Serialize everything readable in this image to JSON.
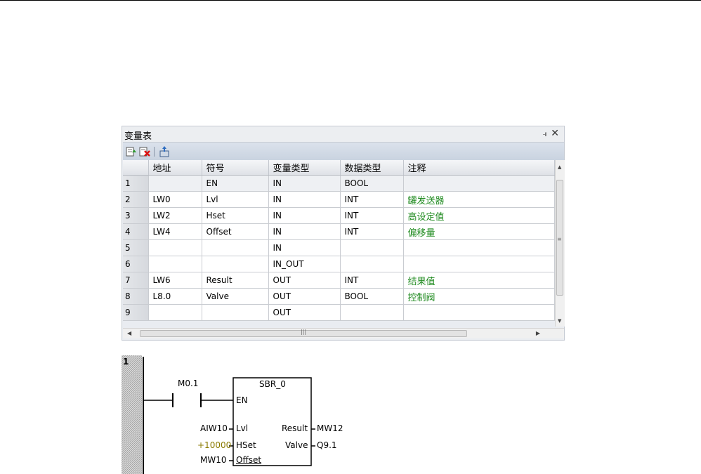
{
  "panel": {
    "title": "变量表",
    "pin_glyph": "ᵖ",
    "close_glyph": "✕"
  },
  "table": {
    "headers": [
      "地址",
      "符号",
      "变量类型",
      "数据类型",
      "注释"
    ],
    "rows": [
      {
        "n": "1",
        "addr": "",
        "sym": "EN",
        "vtype": "IN",
        "dtype": "BOOL",
        "comment": ""
      },
      {
        "n": "2",
        "addr": "LW0",
        "sym": "Lvl",
        "vtype": "IN",
        "dtype": "INT",
        "comment": "罐发送器"
      },
      {
        "n": "3",
        "addr": "LW2",
        "sym": "Hset",
        "vtype": "IN",
        "dtype": "INT",
        "comment": "高设定值"
      },
      {
        "n": "4",
        "addr": "LW4",
        "sym": "Offset",
        "vtype": "IN",
        "dtype": "INT",
        "comment": "偏移量"
      },
      {
        "n": "5",
        "addr": "",
        "sym": "",
        "vtype": "IN",
        "dtype": "",
        "comment": ""
      },
      {
        "n": "6",
        "addr": "",
        "sym": "",
        "vtype": "IN_OUT",
        "dtype": "",
        "comment": ""
      },
      {
        "n": "7",
        "addr": "LW6",
        "sym": "Result",
        "vtype": "OUT",
        "dtype": "INT",
        "comment": "结果值"
      },
      {
        "n": "8",
        "addr": "L8.0",
        "sym": "Valve",
        "vtype": "OUT",
        "dtype": "BOOL",
        "comment": "控制阀"
      },
      {
        "n": "9",
        "addr": "",
        "sym": "",
        "vtype": "OUT",
        "dtype": "",
        "comment": ""
      }
    ]
  },
  "ladder": {
    "network_number": "1",
    "contact_label": "M0.1",
    "block_name": "SBR_0",
    "en_label": "EN",
    "inputs": [
      {
        "operand": "AIW10",
        "pin": "Lvl"
      },
      {
        "operand": "+10000",
        "pin": "HSet"
      },
      {
        "operand": "MW10",
        "pin": "Offset"
      }
    ],
    "outputs": [
      {
        "pin": "Result",
        "operand": "MW12"
      },
      {
        "pin": "Valve",
        "operand": "Q9.1"
      }
    ],
    "constant_color": "#8a7a00"
  }
}
